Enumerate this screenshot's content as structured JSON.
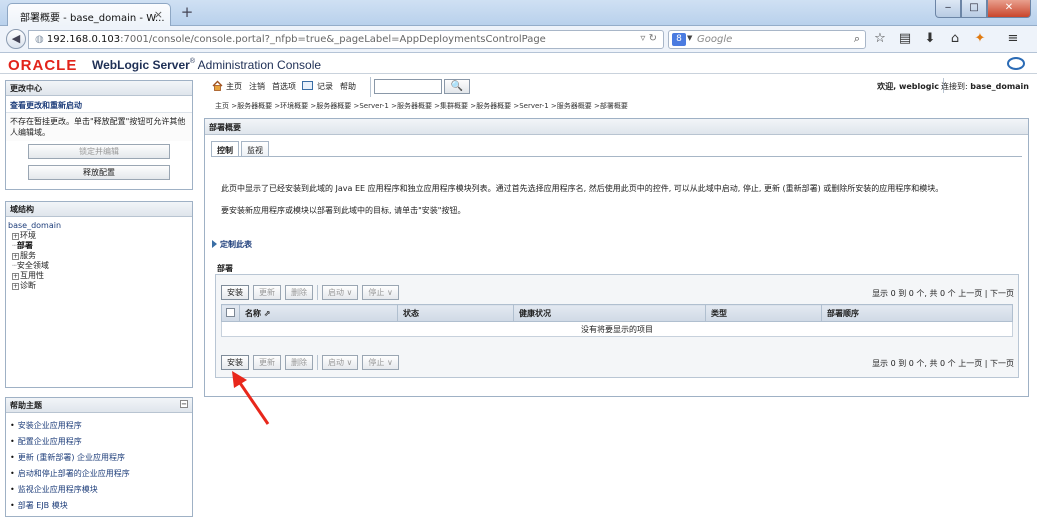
{
  "browser": {
    "tab_title": "部署概要 - base_domain - W...",
    "tab_close": "×",
    "new_tab": "+",
    "url_host": "192.168.0.103",
    "url_rest": ":7001/console/console.portal?_nfpb=true&_pageLabel=AppDeploymentsControlPage",
    "search_placeholder": "Google",
    "window_buttons": [
      "‒",
      "□",
      "✕"
    ]
  },
  "header": {
    "oracle_logo": "ORACLE",
    "product_bold": "WebLogic Server",
    "product_reg": "®",
    "product_rest": " Administration Console"
  },
  "change_center": {
    "title": "更改中心",
    "link": "查看更改和重新启动",
    "message": "不存在暂挂更改。单击\"释放配置\"按钮可允许其他人编辑域。",
    "lock_button": "锁定并编辑",
    "release_button": "释放配置"
  },
  "domain_structure": {
    "title": "域结构",
    "root": "base_domain",
    "nodes": [
      {
        "prefix": "+",
        "label": "环境"
      },
      {
        "prefix": "-",
        "label": "部署"
      },
      {
        "prefix": "+",
        "label": "服务"
      },
      {
        "prefix": "-",
        "label": "安全领域"
      },
      {
        "prefix": "+",
        "label": "互用性"
      },
      {
        "prefix": "+",
        "label": "诊断"
      }
    ]
  },
  "help_topics": {
    "title": "帮助主题",
    "items": [
      "安装企业应用程序",
      "配置企业应用程序",
      "更新 (重新部署) 企业应用程序",
      "启动和停止部署的企业应用程序",
      "监视企业应用程序模块",
      "部署 EJB 模块"
    ]
  },
  "toolbar": {
    "home": "主页",
    "logout": "注销",
    "preferences": "首选项",
    "record": "记录",
    "help": "帮助",
    "welcome": "欢迎, weblogic",
    "connected_label": "连接到:",
    "connected_domain": "base_domain"
  },
  "breadcrumb": "主页 >服务器概要 >环境概要 >服务器概要 >Server-1 >服务器概要 >集群概要 >服务器概要 >Server-1 >服务器概要 >部署概要",
  "main": {
    "panel_title": "部署概要",
    "tabs": [
      "控制",
      "监视"
    ],
    "description1": "此页中显示了已经安装到此域的 Java EE 应用程序和独立应用程序模块列表。通过首先选择应用程序名, 然后使用此页中的控件, 可以从此域中启动, 停止, 更新 (重新部署) 或删除所安装的应用程序和模块。",
    "description2": "要安装新应用程序或模块以部署到此域中的目标, 请单击\"安装\"按钮。",
    "customize": "定制此表",
    "section_title": "部署",
    "buttons": {
      "install": "安装",
      "update": "更新",
      "delete": "删除",
      "start": "启动 ∨",
      "stop": "停止 ∨"
    },
    "pager": "显示 0 到 0 个, 共 0 个  上一页 | 下一页",
    "columns": [
      "名称 ⇗",
      "状态",
      "健康状况",
      "类型",
      "部署顺序"
    ],
    "empty_message": "没有将要显示的项目"
  },
  "colors": {
    "oracle_red": "#e2231a",
    "link_blue": "#1d3d7a",
    "annotation_arrow": "#e8271b"
  }
}
